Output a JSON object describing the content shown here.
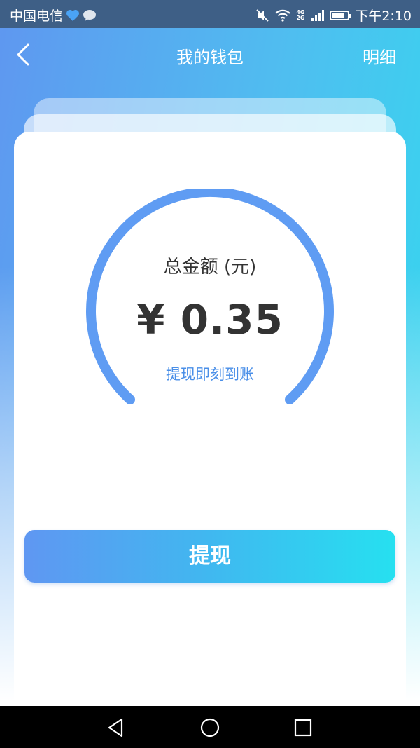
{
  "status_bar": {
    "carrier": "中国电信",
    "network": "4G 2G",
    "time": "下午2:10",
    "battery_level": 0.85
  },
  "header": {
    "title": "我的钱包",
    "detail_label": "明细"
  },
  "balance": {
    "label": "总金额 (元)",
    "amount": "¥ 0.35",
    "note": "提现即刻到账"
  },
  "actions": {
    "withdraw_label": "提现"
  },
  "icons": {
    "back": "chevron-left-icon",
    "mute": "mute-icon",
    "wifi": "wifi-icon",
    "signal": "signal-icon",
    "battery": "battery-icon",
    "heart": "heart-icon",
    "chat": "chat-bubble-icon",
    "nav_back": "triangle-back-icon",
    "nav_home": "circle-home-icon",
    "nav_recent": "square-recent-icon"
  },
  "colors": {
    "accent": "#5f9cf3",
    "gradient_start": "#5f97f0",
    "gradient_end": "#33d9ee",
    "note_text": "#4a8fe8",
    "status_bar": "#3e5f86"
  }
}
